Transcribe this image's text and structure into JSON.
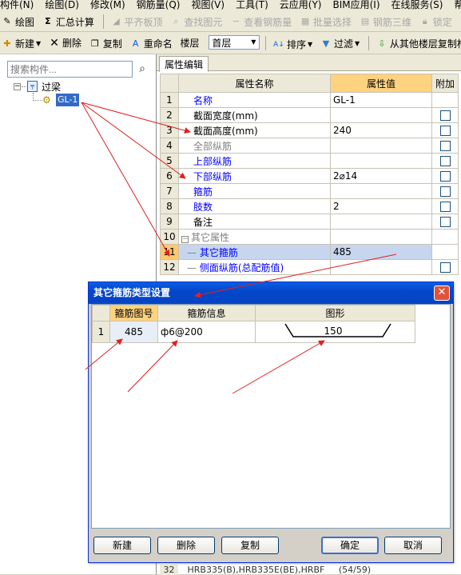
{
  "menu": [
    "构件(N)",
    "绘图(D)",
    "修改(M)",
    "钢筋量(Q)",
    "视图(V)",
    "工具(T)",
    "云应用(Y)",
    "BIM应用(I)",
    "在线服务(S)",
    "帮助(H)"
  ],
  "toolbar1": {
    "draw": "绘图",
    "summary": "汇总计算",
    "flush_slab": "平齐板顶",
    "find_element": "查找图元",
    "view_rebar": "查看钢筋量",
    "batch_select": "批量选择",
    "rebar_3d": "钢筋三维",
    "lock": "锁定"
  },
  "toolbar2": {
    "new": "新建",
    "delete": "删除",
    "copy": "复制",
    "rename": "重命名",
    "floor_label": "楼层",
    "floor_value": "首层",
    "sort": "排序",
    "filter": "过滤",
    "copy_from_floor": "从其他楼层复制构"
  },
  "left_panel": {
    "search_placeholder": "搜索构件...",
    "tree_root": "过梁",
    "tree_child": "GL-1"
  },
  "prop_tab": "属性编辑",
  "prop_table": {
    "headers": [
      "",
      "属性名称",
      "属性值",
      "附加"
    ],
    "rows": [
      {
        "num": "1",
        "name": "名称",
        "value": "GL-1"
      },
      {
        "num": "2",
        "name": "截面宽度(mm)",
        "value": ""
      },
      {
        "num": "3",
        "name": "截面高度(mm)",
        "value": "240"
      },
      {
        "num": "4",
        "name": "全部纵筋",
        "value": ""
      },
      {
        "num": "5",
        "name": "上部纵筋",
        "value": ""
      },
      {
        "num": "6",
        "name": "下部纵筋",
        "value": "2⌀14"
      },
      {
        "num": "7",
        "name": "箍筋",
        "value": ""
      },
      {
        "num": "8",
        "name": "肢数",
        "value": "2"
      },
      {
        "num": "9",
        "name": "备注",
        "value": ""
      },
      {
        "num": "10",
        "name": "其它属性",
        "value": ""
      },
      {
        "num": "11",
        "name": "其它箍筋",
        "value": "485"
      },
      {
        "num": "12",
        "name": "侧面纵筋(总配筋值)",
        "value": ""
      }
    ]
  },
  "dialog": {
    "title": "其它箍筋类型设置",
    "headers": [
      "",
      "箍筋图号",
      "箍筋信息",
      "图形"
    ],
    "row": {
      "num": "1",
      "fig_no": "485",
      "info": "ф6@200",
      "shape_value": "150"
    },
    "buttons": {
      "new": "新建",
      "delete": "删除",
      "copy": "复制",
      "ok": "确定",
      "cancel": "取消"
    }
  },
  "bottom_row": {
    "num": "32",
    "text": "HRB335(B),HRB335E(BE),HRBF",
    "value": "(54/59)"
  },
  "colors": {
    "accent": "#0a5ee6",
    "highlight_header": "#ffd27f",
    "arrow": "#e02020",
    "blue_text": "#0000ff"
  }
}
